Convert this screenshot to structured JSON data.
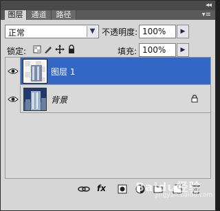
{
  "panel": {
    "tabs": [
      {
        "label": "图层",
        "active": true
      },
      {
        "label": "通道",
        "active": false
      },
      {
        "label": "路径",
        "active": false
      }
    ],
    "collapse_glyph": "◂◂",
    "menu_glyph": "▾≡"
  },
  "blend": {
    "mode": "正常",
    "dropdown_glyph": "▼"
  },
  "opacity": {
    "label": "不透明度:",
    "value": "100%",
    "arrow": "▶"
  },
  "lock": {
    "label": "锁定:",
    "icons": [
      "lock-transparent-icon",
      "lock-brush-icon",
      "lock-move-icon",
      "lock-all-icon"
    ]
  },
  "fill": {
    "label": "填充:",
    "value": "100%",
    "arrow": "▶"
  },
  "layers": [
    {
      "name": "图层 1",
      "selected": true,
      "visible": true,
      "locked": false
    },
    {
      "name": "背景",
      "selected": false,
      "visible": true,
      "locked": true
    }
  ],
  "bottombar": {
    "icons": [
      "link-icon",
      "fx-icon",
      "mask-icon",
      "adjustment-icon",
      "group-icon",
      "new-layer-icon",
      "trash-icon"
    ],
    "fx_label": "fx"
  },
  "watermark": {
    "main": "Baidu经验",
    "sub": "jingyan.baidu.com"
  },
  "colors": {
    "selection": "#3367c6",
    "panel_bg": "#d6d6d6",
    "header": "#4a4a4a"
  }
}
